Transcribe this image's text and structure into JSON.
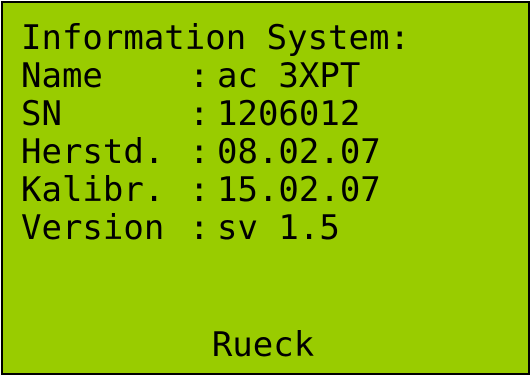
{
  "screen": {
    "title": "Information System:",
    "background_color": "#99cc00",
    "text_color": "#000000",
    "rows": [
      {
        "label": "Name",
        "separator": ":",
        "value": "ac 3XPT"
      },
      {
        "label": "SN",
        "separator": ":",
        "value": "1206012"
      },
      {
        "label": "Herstd.",
        "separator": ":",
        "value": "08.02.07"
      },
      {
        "label": "Kalibr.",
        "separator": ":",
        "value": "15.02.07"
      },
      {
        "label": "Version",
        "separator": ":",
        "value": "sv 1.5"
      }
    ],
    "back_button": "Rueck"
  }
}
